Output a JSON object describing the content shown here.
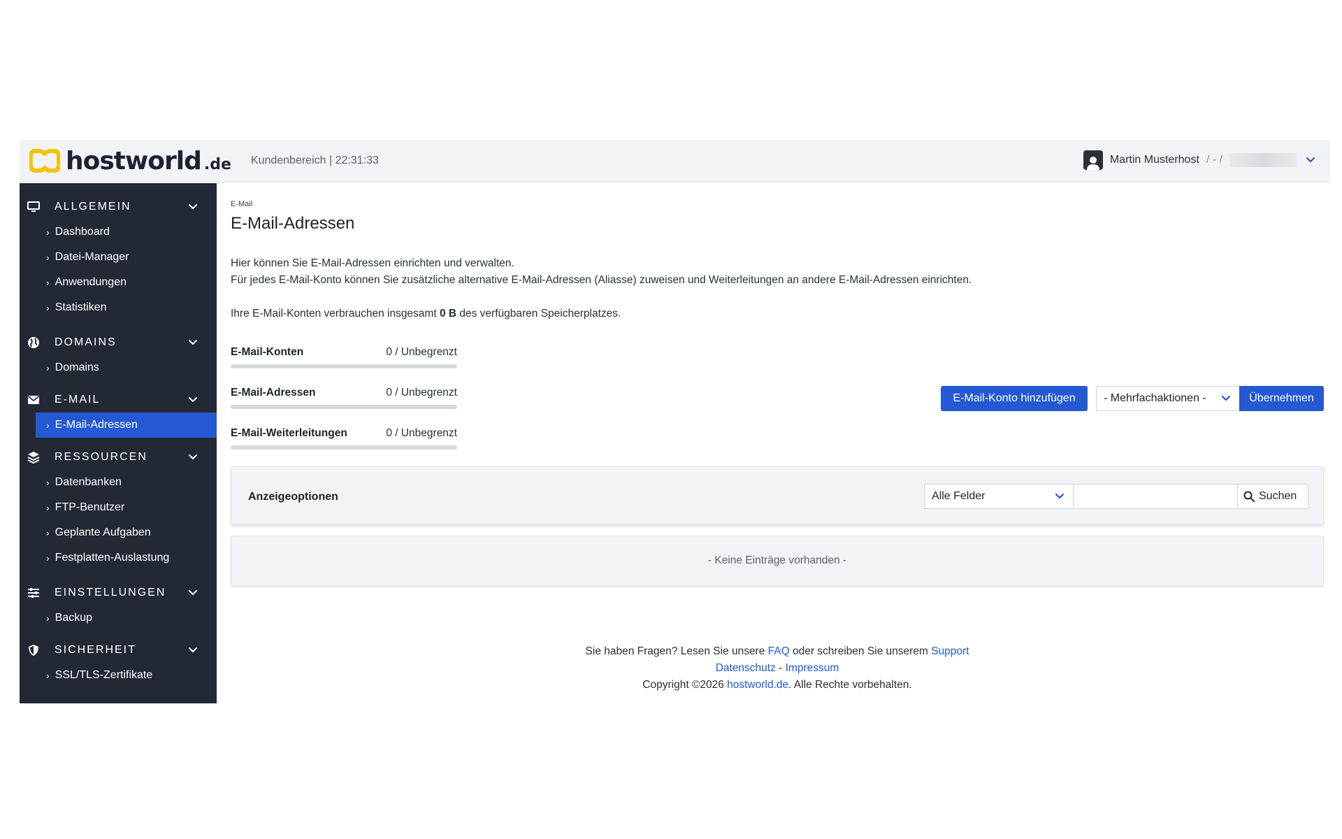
{
  "header": {
    "brand_word": "hostworld",
    "brand_tld": ".de",
    "info": "Kundenbereich | 22:31:33",
    "user_name": "Martin Musterhost",
    "user_sep": "/ - /"
  },
  "sidebar": {
    "sections": [
      {
        "label": "ALLGEMEIN",
        "items": [
          "Dashboard",
          "Datei-Manager",
          "Anwendungen",
          "Statistiken"
        ]
      },
      {
        "label": "DOMAINS",
        "items": [
          "Domains"
        ]
      },
      {
        "label": "E-MAIL",
        "items": [
          "E-Mail-Adressen"
        ]
      },
      {
        "label": "RESSOURCEN",
        "items": [
          "Datenbanken",
          "FTP-Benutzer",
          "Geplante Aufgaben",
          "Festplatten-Auslastung"
        ]
      },
      {
        "label": "EINSTELLUNGEN",
        "items": [
          "Backup"
        ]
      },
      {
        "label": "SICHERHEIT",
        "items": [
          "SSL/TLS-Zertifikate"
        ]
      }
    ]
  },
  "main": {
    "breadcrumb": "E-Mail",
    "title": "E-Mail-Adressen",
    "desc1": "Hier können Sie E-Mail-Adressen einrichten und verwalten.",
    "desc2": "Für jedes E-Mail-Konto können Sie zusätzliche alternative E-Mail-Adressen (Aliasse) zuweisen und Weiterleitungen an andere E-Mail-Adressen einrichten.",
    "storage_pre": "Ihre E-Mail-Konten verbrauchen insgesamt ",
    "storage_value": "0 B",
    "storage_post": " des verfügbaren Speicherplatzes.",
    "stats": [
      {
        "label": "E-Mail-Konten",
        "value": "0 / Unbegrenzt",
        "fill_fraction": 0
      },
      {
        "label": "E-Mail-Adressen",
        "value": "0 / Unbegrenzt",
        "fill_fraction": 0
      },
      {
        "label": "E-Mail-Weiterleitungen",
        "value": "0 / Unbegrenzt",
        "fill_fraction": 0
      }
    ],
    "add_button": "E-Mail-Konto hinzufügen",
    "bulk_select": "- Mehrfachaktionen -",
    "apply_button": "Übernehmen",
    "display_options": {
      "title": "Anzeigeoptionen",
      "field_select": "Alle Felder",
      "search_value": "",
      "search_button": "Suchen"
    },
    "empty_message": "- Keine Einträge vorhanden -"
  },
  "footer": {
    "line1_pre": "Sie haben Fragen? Lesen Sie unsere ",
    "faq": "FAQ",
    "line1_mid": " oder schreiben Sie unserem ",
    "support": "Support",
    "privacy": "Datenschutz",
    "dash": " - ",
    "imprint": "Impressum",
    "copyright_pre": "Copyright ©2026 ",
    "copyright_link": "hostworld.de",
    "copyright_post": ". Alle Rechte vorbehalten."
  },
  "colors": {
    "accent": "#2459d3",
    "sidebar_bg": "#222834",
    "header_bg": "#f2f3f7",
    "logo_yellow": "#f5c300"
  }
}
